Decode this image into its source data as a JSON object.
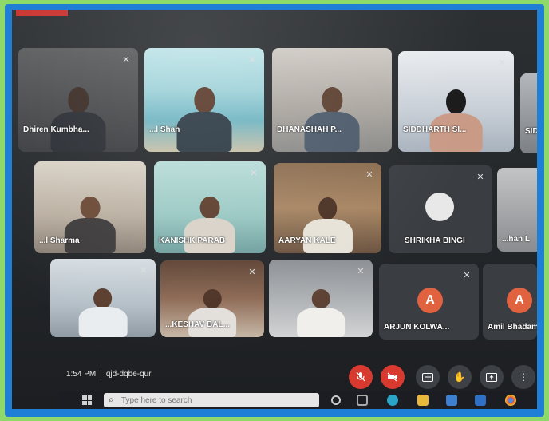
{
  "meeting": {
    "time": "1:54 PM",
    "code": "qjd-dqbe-qur"
  },
  "participants": [
    {
      "name": "Dhiren Kumbha...",
      "muted": true
    },
    {
      "name": "...l Shah",
      "muted": true
    },
    {
      "name": "DHANASHAH P...",
      "muted": false
    },
    {
      "name": "SIDDHARTH SI...",
      "muted": true
    },
    {
      "name": "SID",
      "muted": false
    },
    {
      "name": "...l Sharma",
      "muted": false
    },
    {
      "name": "KANISHK PARAB",
      "muted": true
    },
    {
      "name": "AARYAN KALE",
      "muted": true
    },
    {
      "name": "SHRIKHA BINGI",
      "muted": true
    },
    {
      "name": "...han L",
      "muted": false
    },
    {
      "name": "",
      "muted": true
    },
    {
      "name": "...KESHAV BAL...",
      "muted": true
    },
    {
      "name": "",
      "muted": true
    },
    {
      "name": "ARJUN KOLWA...",
      "initial": "A",
      "avatar_color": "#e0623f",
      "muted": true
    },
    {
      "name": "Amil Bhadam...",
      "initial": "A",
      "avatar_color": "#e0623f",
      "muted": false
    }
  ],
  "controls": {
    "mic": "mic-off-icon",
    "camera": "camera-off-icon",
    "captions": "captions-icon",
    "raise_hand": "hand-icon",
    "present": "present-icon",
    "more": "more-vert-icon"
  },
  "taskbar": {
    "search_placeholder": "Type here to search"
  },
  "colors": {
    "meet_red": "#d93a30",
    "frame_blue": "#1f7fd6",
    "border_green": "#8fd86a"
  }
}
